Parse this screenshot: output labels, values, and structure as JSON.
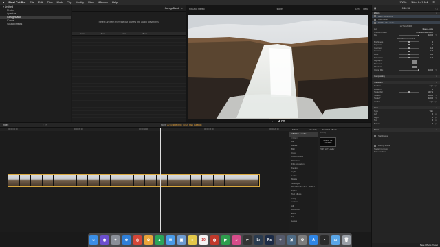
{
  "menubar": {
    "apple": "",
    "app": "Final Cut Pro",
    "items": [
      "File",
      "Edit",
      "Trim",
      "Mark",
      "Clip",
      "Modify",
      "View",
      "Window",
      "Help"
    ],
    "right": [
      "100%",
      "Wed 9:41 AM",
      "☰"
    ]
  },
  "libraries": {
    "items": [
      {
        "label": "Untitled",
        "root": true,
        "selected": false
      },
      {
        "label": "Photos",
        "root": false,
        "selected": false
      },
      {
        "label": "Aperture",
        "root": false,
        "selected": false
      },
      {
        "label": "GarageBand",
        "root": false,
        "selected": true
      },
      {
        "label": "iTunes",
        "root": false,
        "selected": false
      },
      {
        "label": "Sound Effects",
        "root": false,
        "selected": false
      }
    ]
  },
  "browser": {
    "title": "GarageBand",
    "message": "Select an item from the list to view the audio waveform.",
    "columns": [
      "Name",
      "Time",
      "Artist",
      "Album"
    ]
  },
  "viewer": {
    "left_label": "Fit  Only  Stereo",
    "center_label": "stone",
    "zoom": "37%",
    "view_label": "View",
    "timecode": "4:08"
  },
  "timeline": {
    "index_label": "Index",
    "project": "stone",
    "selection_info": "00:00 selected / 00:00 total duration",
    "ruler_marks": [
      "00:00:00:00",
      "00:00:05:00",
      "00:00:10:00",
      "00:00:15:00",
      "00:00:20:00"
    ],
    "thumb_count": 22
  },
  "effects": {
    "tabs": [
      "Effects",
      "4K Only",
      "Installed Effects"
    ],
    "categories": [
      {
        "label": "All Video & Audio",
        "sel": true,
        "grp": false
      },
      {
        "label": "VIDEO",
        "sel": false,
        "grp": true
      },
      {
        "label": "All",
        "sel": false,
        "grp": false
      },
      {
        "label": "Basics",
        "sel": false,
        "grp": false
      },
      {
        "label": "Blur",
        "sel": false,
        "grp": false
      },
      {
        "label": "Color",
        "sel": false,
        "grp": false
      },
      {
        "label": "Color Presets",
        "sel": false,
        "grp": false
      },
      {
        "label": "Distortion",
        "sel": false,
        "grp": false
      },
      {
        "label": "Film Emulation",
        "sel": false,
        "grp": false
      },
      {
        "label": "Keying",
        "sel": false,
        "grp": false
      },
      {
        "label": "Light",
        "sel": false,
        "grp": false
      },
      {
        "label": "Looks",
        "sel": false,
        "grp": false
      },
      {
        "label": "Masks",
        "sel": false,
        "grp": false
      },
      {
        "label": "Nostalgia",
        "sel": false,
        "grp": false
      },
      {
        "label": "Pixel Film Studios - PORT L...",
        "sel": false,
        "grp": false
      },
      {
        "label": "Stylize",
        "sel": false,
        "grp": false
      },
      {
        "label": "Text Effects",
        "sel": false,
        "grp": false
      },
      {
        "label": "Tiling",
        "sel": false,
        "grp": false
      },
      {
        "label": "AUDIO",
        "sel": false,
        "grp": true
      },
      {
        "label": "All",
        "sel": false,
        "grp": false
      },
      {
        "label": "Distortion",
        "sel": false,
        "grp": false
      },
      {
        "label": "Echo",
        "sel": false,
        "grp": false
      },
      {
        "label": "EQ",
        "sel": false,
        "grp": false
      },
      {
        "label": "Levels",
        "sel": false,
        "grp": false
      }
    ],
    "thumb_text": "PORT LUT LOADER",
    "thumb_label": "PORT LUT Loader",
    "tab_label": "4K Only"
  },
  "inspector": {
    "title": "0:12:16",
    "rows": [
      {
        "label": "Effects",
        "type": "hdr"
      },
      {
        "label": "Basic Corrections",
        "type": "sel"
      },
      {
        "label": "Color Board",
        "type": "check"
      },
      {
        "label": "PORT LUT Loader",
        "type": "sel"
      },
      {
        "label": "LUT LOADER",
        "type": "center"
      },
      {
        "label": "Lut",
        "value": "Blade Looks",
        "type": "text"
      },
      {
        "label": "Choose Preset",
        "value": "Choose Custom Lut",
        "type": "text"
      },
      {
        "label": "Mix",
        "value": "100.0",
        "unit": "%",
        "knob": 1.0,
        "type": "slider"
      },
      {
        "label": "IMAGE CONTROLS",
        "type": "center"
      },
      {
        "label": "Brightness",
        "value": "0",
        "knob": 0.5,
        "type": "slider"
      },
      {
        "label": "Exposure",
        "value": "0",
        "knob": 0.5,
        "type": "slider"
      },
      {
        "label": "Contrast",
        "value": "1.0",
        "knob": 0.5,
        "type": "slider"
      },
      {
        "label": "Gamma",
        "value": "1.0",
        "knob": 0.5,
        "type": "slider"
      },
      {
        "label": "Pivot",
        "value": "0.5",
        "knob": 0.5,
        "type": "slider"
      },
      {
        "label": "Saturation",
        "value": "1.0",
        "knob": 0.5,
        "type": "slider"
      },
      {
        "label": "Highlights",
        "type": "swatch"
      },
      {
        "label": "Midtones",
        "type": "swatch"
      },
      {
        "label": "Shadows",
        "type": "swatch"
      },
      {
        "label": "Global Mix",
        "value": "100.0",
        "unit": "%",
        "knob": 1.0,
        "type": "slider"
      },
      {
        "label": "",
        "type": "blank"
      },
      {
        "label": "Compositing",
        "type": "hdr"
      },
      {
        "label": "",
        "type": "blank"
      },
      {
        "label": "Transform",
        "type": "hdr"
      },
      {
        "label": "Position",
        "value": "0 px",
        "unit": "0 px",
        "type": "text"
      },
      {
        "label": "Rotation",
        "value": "0",
        "unit": "°",
        "type": "text"
      },
      {
        "label": "Scale (All)",
        "value": "100 %",
        "knob": 0.5,
        "type": "slider"
      },
      {
        "label": "Scale X",
        "value": "100.0",
        "unit": "%",
        "type": "text"
      },
      {
        "label": "Scale Y",
        "value": "100.0",
        "unit": "%",
        "type": "text"
      },
      {
        "label": "Anchor",
        "value": "0 px",
        "unit": "0 px",
        "type": "text"
      },
      {
        "label": "",
        "type": "blank"
      },
      {
        "label": "Crop",
        "type": "hdr"
      },
      {
        "label": "Type",
        "value": "Trim",
        "type": "text"
      },
      {
        "label": "Left",
        "value": "0",
        "unit": "px",
        "type": "text"
      },
      {
        "label": "Right",
        "value": "0",
        "unit": "px",
        "type": "text"
      },
      {
        "label": "Top",
        "value": "0",
        "unit": "px",
        "type": "text"
      },
      {
        "label": "Bottom",
        "value": "0",
        "unit": "px",
        "type": "text"
      },
      {
        "label": "",
        "type": "blank"
      },
      {
        "label": "Distort",
        "type": "hdr"
      },
      {
        "label": "",
        "type": "blank"
      },
      {
        "label": "Stabilization",
        "type": "check"
      },
      {
        "label": "",
        "type": "blank"
      },
      {
        "label": "",
        "type": "blank"
      },
      {
        "label": "Rolling Shutter",
        "type": "check"
      },
      {
        "label": "Spatial Conform",
        "type": "plain"
      },
      {
        "label": "Rate Conform",
        "type": "plain"
      }
    ],
    "bottom_button": "Save Effects Preset"
  },
  "dock": {
    "icons": [
      {
        "name": "finder-icon",
        "color": "#3a8ee6",
        "glyph": "☺"
      },
      {
        "name": "siri-icon",
        "color": "#6b4fcf",
        "glyph": "◉"
      },
      {
        "name": "launchpad-icon",
        "color": "#8a8f99",
        "glyph": "✦"
      },
      {
        "name": "safari-icon",
        "color": "#2f7fd8",
        "glyph": "⊕"
      },
      {
        "name": "chrome-icon",
        "color": "#d44638",
        "glyph": "◎"
      },
      {
        "name": "photos-icon",
        "color": "#e9a53a",
        "glyph": "✿"
      },
      {
        "name": "drive-icon",
        "color": "#2aa55a",
        "glyph": "▲"
      },
      {
        "name": "mail-icon",
        "color": "#4a9be8",
        "glyph": "✉"
      },
      {
        "name": "preview-icon",
        "color": "#6d9bd1",
        "glyph": "▣"
      },
      {
        "name": "notes-icon",
        "color": "#e3c84a",
        "glyph": "≡"
      },
      {
        "name": "calendar-icon",
        "color": "#f2f2f2",
        "glyph": "10"
      },
      {
        "name": "photo-booth-icon",
        "color": "#c0392b",
        "glyph": "◍"
      },
      {
        "name": "facetime-icon",
        "color": "#2e9e4d",
        "glyph": "▶"
      },
      {
        "name": "itunes-icon",
        "color": "#d64c8a",
        "glyph": "♫"
      },
      {
        "name": "final-cut-icon",
        "color": "#333333",
        "glyph": "✂"
      },
      {
        "name": "lightroom-icon",
        "color": "#2a3b4f",
        "glyph": "Lr"
      },
      {
        "name": "photoshop-icon",
        "color": "#1c2b46",
        "glyph": "Ps"
      },
      {
        "name": "motion-icon",
        "color": "#555a6b",
        "glyph": "✧"
      },
      {
        "name": "compressor-icon",
        "color": "#4e6b85",
        "glyph": "⇲"
      },
      {
        "name": "system-preferences-icon",
        "color": "#7d7d7d",
        "glyph": "⚙"
      },
      {
        "name": "app-store-icon",
        "color": "#2f86e6",
        "glyph": "A"
      },
      {
        "name": "logic-icon",
        "color": "#2b2b2b",
        "glyph": "◔"
      },
      {
        "name": "folder-icon",
        "color": "#5aa6e8",
        "glyph": "▭"
      },
      {
        "name": "trash-icon",
        "color": "#9aa0a8",
        "glyph": "🗑"
      }
    ]
  }
}
